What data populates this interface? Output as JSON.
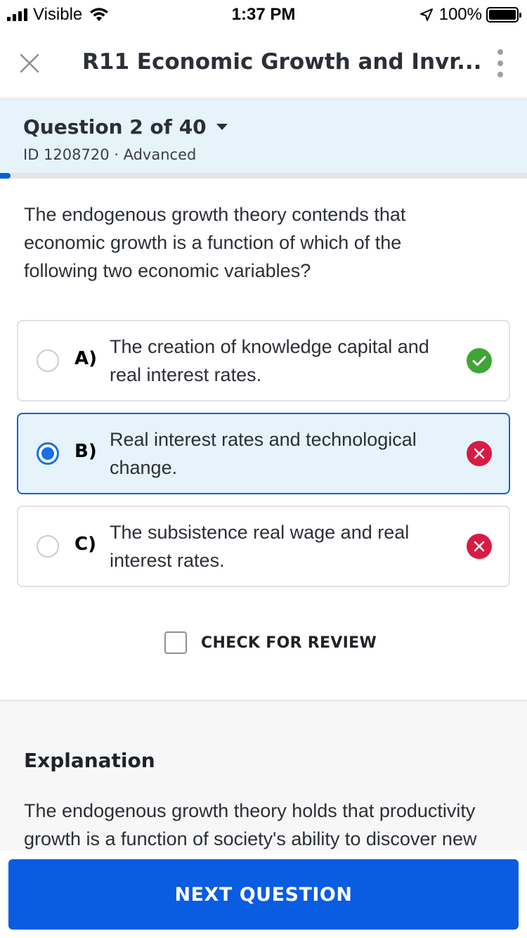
{
  "status_bar": {
    "carrier": "Visible",
    "time": "1:37 PM",
    "battery_pct": "100%"
  },
  "header": {
    "title": "R11 Economic Growth and Invr..."
  },
  "question_banner": {
    "title": "Question 2 of 40",
    "meta": "ID 1208720 · Advanced",
    "progress_fraction": 0.02
  },
  "question": {
    "text": "The endogenous growth theory contends that economic growth is a function of which of the following two economic variables?"
  },
  "answers": [
    {
      "letter": "A)",
      "text": "The creation of knowledge capital and real interest rates.",
      "selected": false,
      "status": "correct"
    },
    {
      "letter": "B)",
      "text": "Real interest rates and technological change.",
      "selected": true,
      "status": "wrong"
    },
    {
      "letter": "C)",
      "text": "The subsistence real wage and real interest rates.",
      "selected": false,
      "status": "wrong"
    }
  ],
  "review": {
    "label": "CHECK FOR REVIEW",
    "checked": false
  },
  "explanation": {
    "title": "Explanation",
    "text": "The endogenous growth theory holds that productivity growth is a function of society's ability to discover new"
  },
  "footer": {
    "next_label": "NEXT QUESTION"
  },
  "colors": {
    "primary": "#0a5ce0",
    "banner_bg": "#e6f3fb",
    "correct": "#3fa535",
    "wrong": "#d81b44"
  }
}
